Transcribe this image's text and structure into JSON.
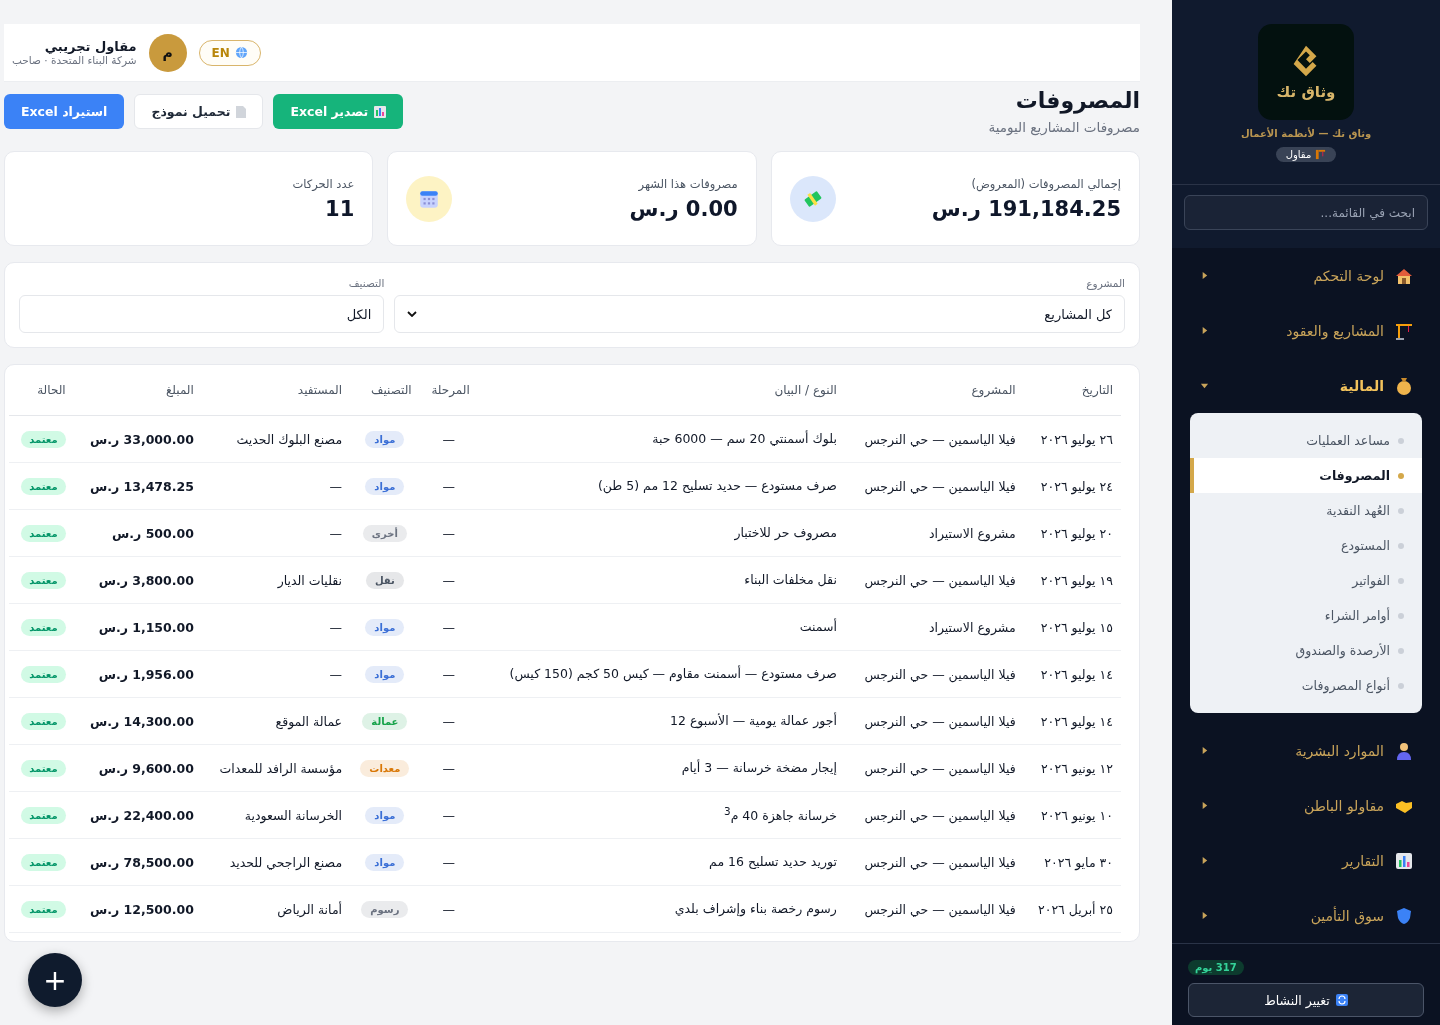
{
  "topbar": {
    "language": "EN",
    "avatar": "م",
    "user_name": "مقاول تجريبي",
    "user_subtitle": "شركة البناء المتحدة · صاحب"
  },
  "page": {
    "title": "المصروفات",
    "subtitle": "مصروفات المشاريع اليومية"
  },
  "actions": [
    {
      "label": "تصدير Excel",
      "kind": "export"
    },
    {
      "label": "تحميل نموذج",
      "kind": "template"
    },
    {
      "label": "استيراد Excel",
      "kind": "import"
    }
  ],
  "stats": [
    {
      "label": "إجمالي المصروفات (المعروض)",
      "value": "191,184.25 ر.س",
      "kind": "money"
    },
    {
      "label": "مصروفات هذا الشهر",
      "value": "0.00 ر.س",
      "kind": "calendar"
    },
    {
      "label": "عدد الحركات",
      "value": "11",
      "kind": "count"
    }
  ],
  "filters": [
    {
      "label": "المشروع",
      "value": "كل المشاريع",
      "kind": "dropdown"
    },
    {
      "label": "التصنيف",
      "value": "الكل",
      "kind": "plain"
    }
  ],
  "table": {
    "columns": [
      "التاريخ",
      "المشروع",
      "النوع / البيان",
      "المرحلة",
      "التصنيف",
      "المستفيد",
      "المبلغ",
      "الحالة"
    ],
    "rows": [
      {
        "date": "٢٦ يوليو ٢٠٢٦",
        "project": "فيلا الياسمين — حي النرجس",
        "description": "بلوك أسمنتي 20 سم — 6000 حبة",
        "stage": "—",
        "category": {
          "label": "مواد",
          "color": "#3b6fd6"
        },
        "beneficiary": "مصنع البلوك الحديث",
        "amount": "33,000.00 ر.س",
        "status": "معتمد"
      },
      {
        "date": "٢٤ يوليو ٢٠٢٦",
        "project": "فيلا الياسمين — حي النرجس",
        "description": "صرف مستودع — حديد تسليح 12 مم (5 طن)",
        "stage": "—",
        "category": {
          "label": "مواد",
          "color": "#3b6fd6"
        },
        "beneficiary": "—",
        "amount": "13,478.25 ر.س",
        "status": "معتمد"
      },
      {
        "date": "٢٠ يوليو ٢٠٢٦",
        "project": "مشروع الاستيراد",
        "description": "مصروف حر للاختبار",
        "stage": "—",
        "category": {
          "label": "أخرى",
          "color": "#6b7280"
        },
        "beneficiary": "—",
        "amount": "500.00 ر.س",
        "status": "معتمد"
      },
      {
        "date": "١٩ يوليو ٢٠٢٦",
        "project": "فيلا الياسمين — حي النرجس",
        "description": "نقل مخلفات البناء",
        "stage": "—",
        "category": {
          "label": "نقل",
          "color": "#4b5563"
        },
        "beneficiary": "نقليات الديار",
        "amount": "3,800.00 ر.س",
        "status": "معتمد"
      },
      {
        "date": "١٥ يوليو ٢٠٢٦",
        "project": "مشروع الاستيراد",
        "description": "أسمنت",
        "stage": "—",
        "category": {
          "label": "مواد",
          "color": "#3b6fd6"
        },
        "beneficiary": "—",
        "amount": "1,150.00 ر.س",
        "status": "معتمد"
      },
      {
        "date": "١٤ يوليو ٢٠٢٦",
        "project": "فيلا الياسمين — حي النرجس",
        "description": "صرف مستودع — أسمنت مقاوم — كيس 50 كجم (150 كيس)",
        "stage": "—",
        "category": {
          "label": "مواد",
          "color": "#3b6fd6"
        },
        "beneficiary": "—",
        "amount": "1,956.00 ر.س",
        "status": "معتمد"
      },
      {
        "date": "١٤ يوليو ٢٠٢٦",
        "project": "فيلا الياسمين — حي النرجس",
        "description": "أجور عمالة يومية — الأسبوع 12",
        "stage": "—",
        "category": {
          "label": "عمالة",
          "color": "#16a34a"
        },
        "beneficiary": "عمالة الموقع",
        "amount": "14,300.00 ر.س",
        "status": "معتمد"
      },
      {
        "date": "١٢ يونيو ٢٠٢٦",
        "project": "فيلا الياسمين — حي النرجس",
        "description": "إيجار مضخة خرسانة — 3 أيام",
        "stage": "—",
        "category": {
          "label": "معدات",
          "color": "#d97706"
        },
        "beneficiary": "مؤسسة الرافد للمعدات",
        "amount": "9,600.00 ر.س",
        "status": "معتمد"
      },
      {
        "date": "١٠ يونيو ٢٠٢٦",
        "project": "فيلا الياسمين — حي النرجس",
        "description": "خرسانة جاهزة 40 م$^{3}$",
        "stage": "—",
        "category": {
          "label": "مواد",
          "color": "#3b6fd6"
        },
        "beneficiary": "الخرسانة السعودية",
        "amount": "22,400.00 ر.س",
        "status": "معتمد"
      },
      {
        "date": "٣٠ مايو ٢٠٢٦",
        "project": "فيلا الياسمين — حي النرجس",
        "description": "توريد حديد تسليح 16 مم",
        "stage": "—",
        "category": {
          "label": "مواد",
          "color": "#3b6fd6"
        },
        "beneficiary": "مصنع الراجحي للحديد",
        "amount": "78,500.00 ر.س",
        "status": "معتمد"
      },
      {
        "date": "٢٥ أبريل ٢٠٢٦",
        "project": "فيلا الياسمين — حي النرجس",
        "description": "رسوم رخصة بناء وإشراف بلدي",
        "stage": "—",
        "category": {
          "label": "رسوم",
          "color": "#6b7280"
        },
        "beneficiary": "أمانة الرياض",
        "amount": "12,500.00 ر.س",
        "status": "معتمد"
      }
    ]
  },
  "fab": {
    "label": "+"
  },
  "sidebar": {
    "logo_text": "وثاق تك",
    "brand": "وثاق تك — لأنظمة الأعمال",
    "role": "مقاول",
    "search": {
      "placeholder": "ابحث في القائمة..."
    },
    "items": [
      {
        "label": "لوحة التحكم",
        "expanded": false
      },
      {
        "label": "المشاريع والعقود",
        "expanded": false
      },
      {
        "label": "المالية",
        "expanded": true,
        "children": [
          {
            "label": "مساعد العمليات",
            "selected": false
          },
          {
            "label": "المصروفات",
            "selected": true
          },
          {
            "label": "العُهد النقدية",
            "selected": false
          },
          {
            "label": "المستودع",
            "selected": false
          },
          {
            "label": "الفواتير",
            "selected": false
          },
          {
            "label": "أوامر الشراء",
            "selected": false
          },
          {
            "label": "الأرصدة والصندوق",
            "selected": false
          },
          {
            "label": "أنواع المصروفات",
            "selected": false
          }
        ]
      },
      {
        "label": "الموارد البشرية",
        "expanded": false
      },
      {
        "label": "مقاولو الباطن",
        "expanded": false
      },
      {
        "label": "التقارير",
        "expanded": false
      },
      {
        "label": "سوق التأمين",
        "expanded": false
      }
    ],
    "days_left": "317 يوم",
    "switch_button": "تغيير النشاط"
  }
}
